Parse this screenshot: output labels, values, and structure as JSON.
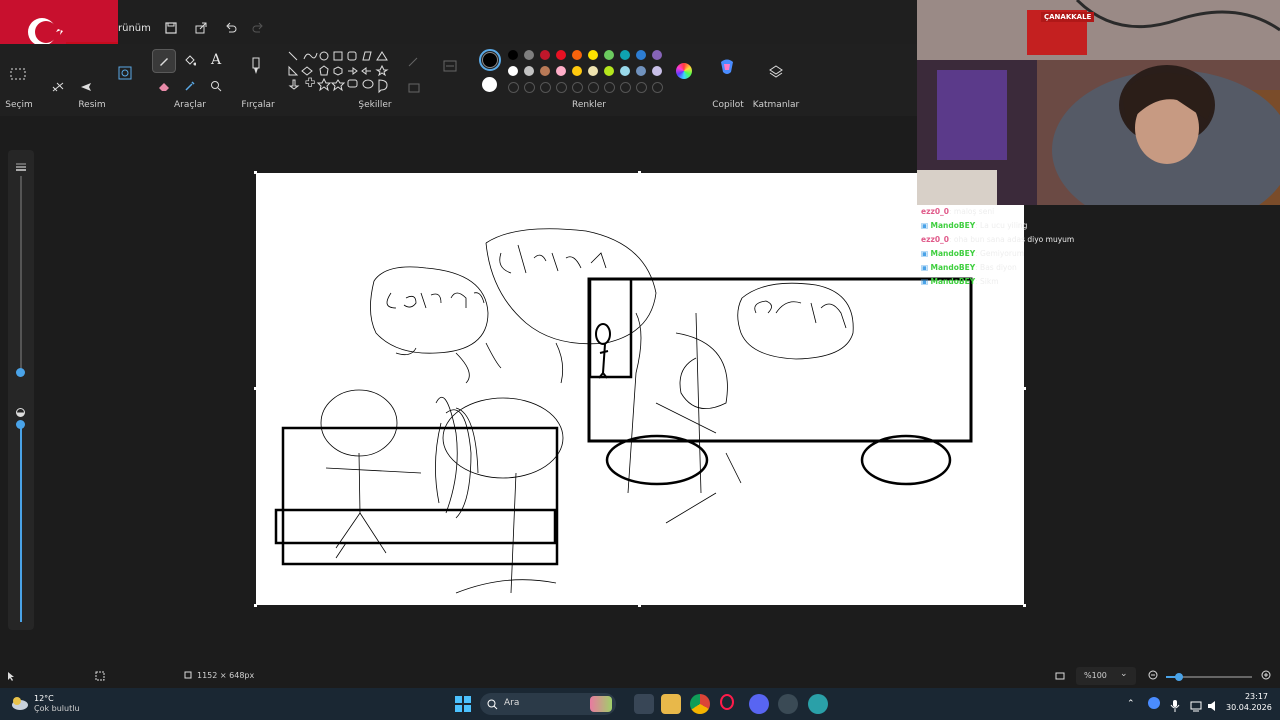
{
  "menu": {
    "view_partial": "rünüm"
  },
  "ribbon": {
    "groups": [
      {
        "label": "Seçim"
      },
      {
        "label": "Resim"
      },
      {
        "label": "Araçlar"
      },
      {
        "label": "Fırçalar"
      },
      {
        "label": "Şekiller"
      },
      {
        "label": "Renkler"
      },
      {
        "label": "Copilot"
      },
      {
        "label": "Katmanlar"
      }
    ],
    "text_tool_glyph": "A"
  },
  "palette": {
    "row1": [
      "#000000",
      "#7f7f7f",
      "#c0172b",
      "#e81123",
      "#f7630c",
      "#fce100",
      "#6ccb5f",
      "#0fa3b1",
      "#2d7dd2",
      "#8764b8"
    ],
    "row2": [
      "#ffffff",
      "#c3c3c3",
      "#b97a57",
      "#ffaec9",
      "#ffc90e",
      "#efe4b0",
      "#b5e61d",
      "#99d9ea",
      "#7092be",
      "#c8bfe7"
    ],
    "primary": "#000000",
    "secondary": "#ffffff"
  },
  "status": {
    "canvas_size": "1152 × 648px",
    "zoom": "%100"
  },
  "chat": [
    {
      "user": "ezz0_0",
      "user_color": "#e05a8a",
      "msg": ": maloş seni"
    },
    {
      "user": "MandoBEY",
      "user_color": "#3fcf3f",
      "msg": ": La ucu yiling"
    },
    {
      "user": "ezz0_0",
      "user_color": "#e05a8a",
      "msg": ": oha bun sana adas diyo muyum"
    },
    {
      "user": "MandoBEY",
      "user_color": "#3fcf3f",
      "msg": ": Gemiyorum"
    },
    {
      "user": "MandoBEY",
      "user_color": "#3fcf3f",
      "msg": ": Bas diyon"
    },
    {
      "user": "MandoBEY",
      "user_color": "#3fcf3f",
      "msg": ": Sikm"
    }
  ],
  "taskbar": {
    "weather_temp": "12°C",
    "weather_desc": "Çok bulutlu",
    "search_label": "Ara",
    "time": "23:17",
    "date": "30.04.2026"
  },
  "webcam": {
    "banner": "ÇANAKKALE"
  }
}
